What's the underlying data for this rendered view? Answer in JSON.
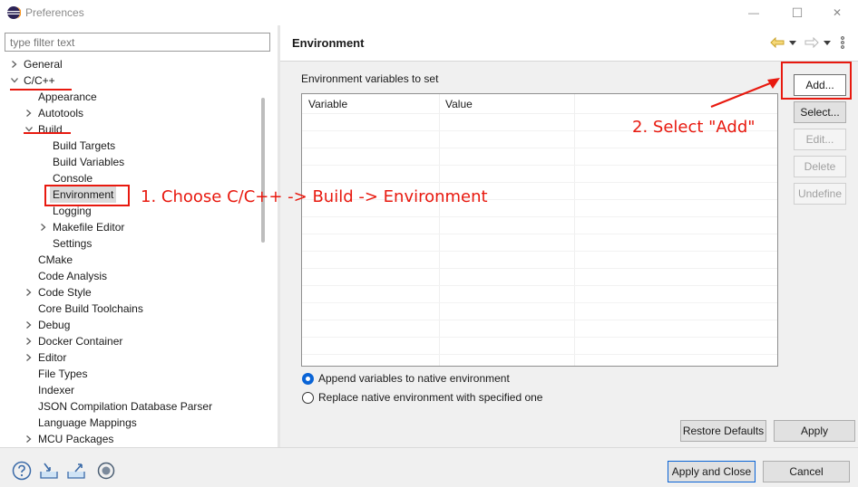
{
  "window": {
    "title": "Preferences",
    "minimize_glyph": "—",
    "maximize_glyph": "☐",
    "close_glyph": "✕"
  },
  "filter": {
    "placeholder": "type filter text"
  },
  "tree": [
    {
      "label": "General",
      "level": 0,
      "chevron": "right"
    },
    {
      "label": "C/C++",
      "level": 0,
      "chevron": "down"
    },
    {
      "label": "Appearance",
      "level": 1,
      "chevron": "none"
    },
    {
      "label": "Autotools",
      "level": 1,
      "chevron": "right"
    },
    {
      "label": "Build",
      "level": 1,
      "chevron": "down"
    },
    {
      "label": "Build Targets",
      "level": 2,
      "chevron": "none"
    },
    {
      "label": "Build Variables",
      "level": 2,
      "chevron": "none"
    },
    {
      "label": "Console",
      "level": 2,
      "chevron": "none"
    },
    {
      "label": "Environment",
      "level": 2,
      "chevron": "none",
      "selected": true
    },
    {
      "label": "Logging",
      "level": 2,
      "chevron": "none"
    },
    {
      "label": "Makefile Editor",
      "level": 2,
      "chevron": "right"
    },
    {
      "label": "Settings",
      "level": 2,
      "chevron": "none"
    },
    {
      "label": "CMake",
      "level": 1,
      "chevron": "none"
    },
    {
      "label": "Code Analysis",
      "level": 1,
      "chevron": "none"
    },
    {
      "label": "Code Style",
      "level": 1,
      "chevron": "right"
    },
    {
      "label": "Core Build Toolchains",
      "level": 1,
      "chevron": "none"
    },
    {
      "label": "Debug",
      "level": 1,
      "chevron": "right"
    },
    {
      "label": "Docker Container",
      "level": 1,
      "chevron": "right"
    },
    {
      "label": "Editor",
      "level": 1,
      "chevron": "right"
    },
    {
      "label": "File Types",
      "level": 1,
      "chevron": "none"
    },
    {
      "label": "Indexer",
      "level": 1,
      "chevron": "none"
    },
    {
      "label": "JSON Compilation Database Parser",
      "level": 1,
      "chevron": "none"
    },
    {
      "label": "Language Mappings",
      "level": 1,
      "chevron": "none"
    },
    {
      "label": "MCU Packages",
      "level": 1,
      "chevron": "right"
    }
  ],
  "page": {
    "title": "Environment",
    "section_label": "Environment variables to set",
    "columns": [
      "Variable",
      "Value"
    ],
    "side_buttons": [
      {
        "label": "Add...",
        "enabled": true
      },
      {
        "label": "Select...",
        "enabled": true
      },
      {
        "label": "Edit...",
        "enabled": false
      },
      {
        "label": "Delete",
        "enabled": false
      },
      {
        "label": "Undefine",
        "enabled": false
      }
    ],
    "radios": [
      {
        "label": "Append variables to native environment",
        "checked": true
      },
      {
        "label": "Replace native environment with specified one",
        "checked": false
      }
    ],
    "restore_defaults": "Restore Defaults",
    "apply": "Apply"
  },
  "footer": {
    "apply_and_close": "Apply and Close",
    "cancel": "Cancel"
  },
  "annotations": {
    "step1": "1. Choose C/C++ -> Build -> Environment",
    "step2": "2. Select \"Add\""
  },
  "colors": {
    "annotation": "#e8190f",
    "focus_blue": "#0a64d6",
    "selection": "#dadada"
  }
}
